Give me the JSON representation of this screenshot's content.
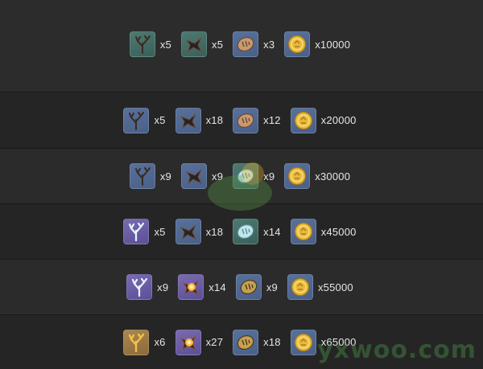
{
  "rows": [
    {
      "items": [
        {
          "icon": "branch-coral-icon",
          "bg": "green",
          "qty": "x5"
        },
        {
          "icon": "dark-horn-icon",
          "bg": "green",
          "qty": "x5"
        },
        {
          "icon": "scale-fragment-icon",
          "bg": "blue",
          "qty": "x3"
        },
        {
          "icon": "gold-coin-icon",
          "bg": "blue",
          "qty": "x10000"
        }
      ]
    },
    {
      "items": [
        {
          "icon": "branch-coral-icon",
          "bg": "blue",
          "qty": "x5"
        },
        {
          "icon": "dark-horn-icon",
          "bg": "blue",
          "qty": "x18"
        },
        {
          "icon": "scale-fragment-icon",
          "bg": "blue",
          "qty": "x12"
        },
        {
          "icon": "gold-coin-icon",
          "bg": "blue",
          "qty": "x20000"
        }
      ]
    },
    {
      "items": [
        {
          "icon": "branch-coral-icon",
          "bg": "blue",
          "qty": "x9"
        },
        {
          "icon": "dark-horn-icon",
          "bg": "blue",
          "qty": "x9"
        },
        {
          "icon": "crystal-scale-icon",
          "bg": "green",
          "qty": "x9"
        },
        {
          "icon": "gold-coin-icon",
          "bg": "blue",
          "qty": "x30000"
        }
      ]
    },
    {
      "items": [
        {
          "icon": "white-coral-icon",
          "bg": "purple",
          "qty": "x5"
        },
        {
          "icon": "dark-horn-icon",
          "bg": "blue",
          "qty": "x18"
        },
        {
          "icon": "crystal-scale-icon",
          "bg": "green",
          "qty": "x14"
        },
        {
          "icon": "gold-coin-icon",
          "bg": "blue",
          "qty": "x45000"
        }
      ]
    },
    {
      "items": [
        {
          "icon": "white-coral-icon",
          "bg": "purple",
          "qty": "x9"
        },
        {
          "icon": "fire-horn-icon",
          "bg": "purple",
          "qty": "x14"
        },
        {
          "icon": "golden-scale-icon",
          "bg": "blue",
          "qty": "x9"
        },
        {
          "icon": "gold-coin-icon",
          "bg": "blue",
          "qty": "x55000"
        }
      ]
    },
    {
      "items": [
        {
          "icon": "golden-coral-icon",
          "bg": "gold",
          "qty": "x6"
        },
        {
          "icon": "fire-horn-icon",
          "bg": "purple",
          "qty": "x27"
        },
        {
          "icon": "golden-scale-icon",
          "bg": "blue",
          "qty": "x18"
        },
        {
          "icon": "gold-coin-icon",
          "bg": "blue",
          "qty": "x65000"
        }
      ]
    }
  ],
  "watermark": "yxwoo.com"
}
